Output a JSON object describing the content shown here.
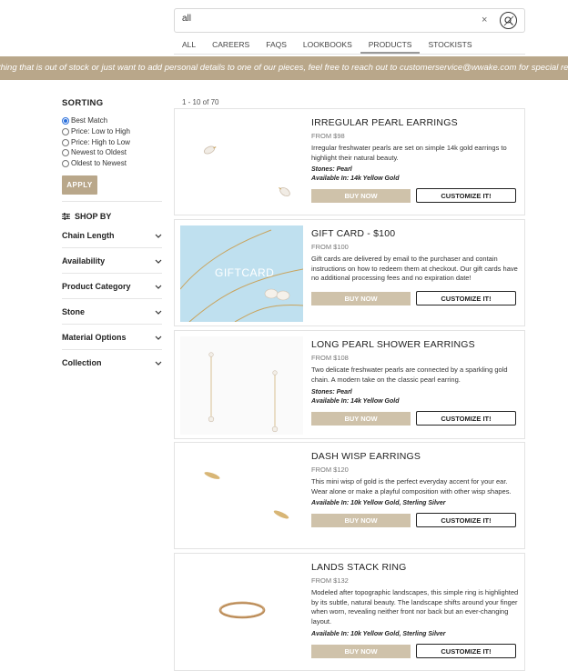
{
  "search": {
    "value": "all",
    "placeholder": "",
    "clear_icon": "close-icon",
    "submit_icon": "search-icon"
  },
  "tabs": [
    {
      "label": "ALL"
    },
    {
      "label": "CAREERS"
    },
    {
      "label": "FAQS"
    },
    {
      "label": "LOOKBOOKS"
    },
    {
      "label": "PRODUCTS"
    },
    {
      "label": "STOCKISTS"
    }
  ],
  "active_tab": "PRODUCTS",
  "banner": {
    "text": "thing that is out of stock or just want to add personal details to one of our pieces, feel free to reach out to customerservice@wwake.com for special requests. We l",
    "color": "#b9a78a"
  },
  "sidebar": {
    "sorting_title": "SORTING",
    "sort_options": [
      {
        "label": "Best Match",
        "checked": true
      },
      {
        "label": "Price: Low to High",
        "checked": false
      },
      {
        "label": "Price: High to Low",
        "checked": false
      },
      {
        "label": "Newest to Oldest",
        "checked": false
      },
      {
        "label": "Oldest to Newest",
        "checked": false
      }
    ],
    "apply_label": "APPLY",
    "shop_by_label": "SHOP BY",
    "filters": [
      {
        "label": "Chain Length"
      },
      {
        "label": "Availability"
      },
      {
        "label": "Product Category"
      },
      {
        "label": "Stone"
      },
      {
        "label": "Material Options"
      },
      {
        "label": "Collection"
      }
    ]
  },
  "results": {
    "count_text": "1 - 10 of 70",
    "buy_label": "BUY NOW",
    "customize_label": "CUSTOMIZE IT!",
    "products": [
      {
        "title": "IRREGULAR PEARL EARRINGS",
        "price": "FROM $98",
        "description": "Irregular freshwater pearls are set on simple 14k gold earrings to highlight their natural beauty.",
        "stones": "Stones: Pearl",
        "available": "Available In: 14k Yellow Gold"
      },
      {
        "title": "GIFT CARD - $100",
        "price": "FROM $100",
        "description": "Gift cards are delivered by email to the purchaser and contain instructions on how to redeem them at checkout. Our gift cards have no additional processing fees and no expiration date!",
        "image_text": "GIFTCARD"
      },
      {
        "title": "LONG PEARL SHOWER EARRINGS",
        "price": "FROM $108",
        "description": "Two delicate freshwater pearls are connected by a sparkling gold chain. A modern take on the classic pearl earring.",
        "stones": "Stones: Pearl",
        "available": "Available In: 14k Yellow Gold"
      },
      {
        "title": "DASH WISP EARRINGS",
        "price": "FROM $120",
        "description": "This mini wisp of gold is the perfect everyday accent for your ear. Wear alone or make a playful composition with other wisp shapes.",
        "available": "Available In: 10k Yellow Gold, Sterling Silver"
      },
      {
        "title": "LANDS STACK RING",
        "price": "FROM $132",
        "description": "Modeled after topographic landscapes, this simple ring is highlighted by its subtle, natural beauty. The landscape shifts around your finger when worn, revealing neither front nor back but an ever-changing layout.",
        "available": "Available In: 10k Yellow Gold, Sterling Silver"
      }
    ]
  },
  "colors": {
    "accent": "#b9a78a",
    "button_light": "#cfc2aa",
    "giftcard_bg": "#bfe0ef"
  }
}
